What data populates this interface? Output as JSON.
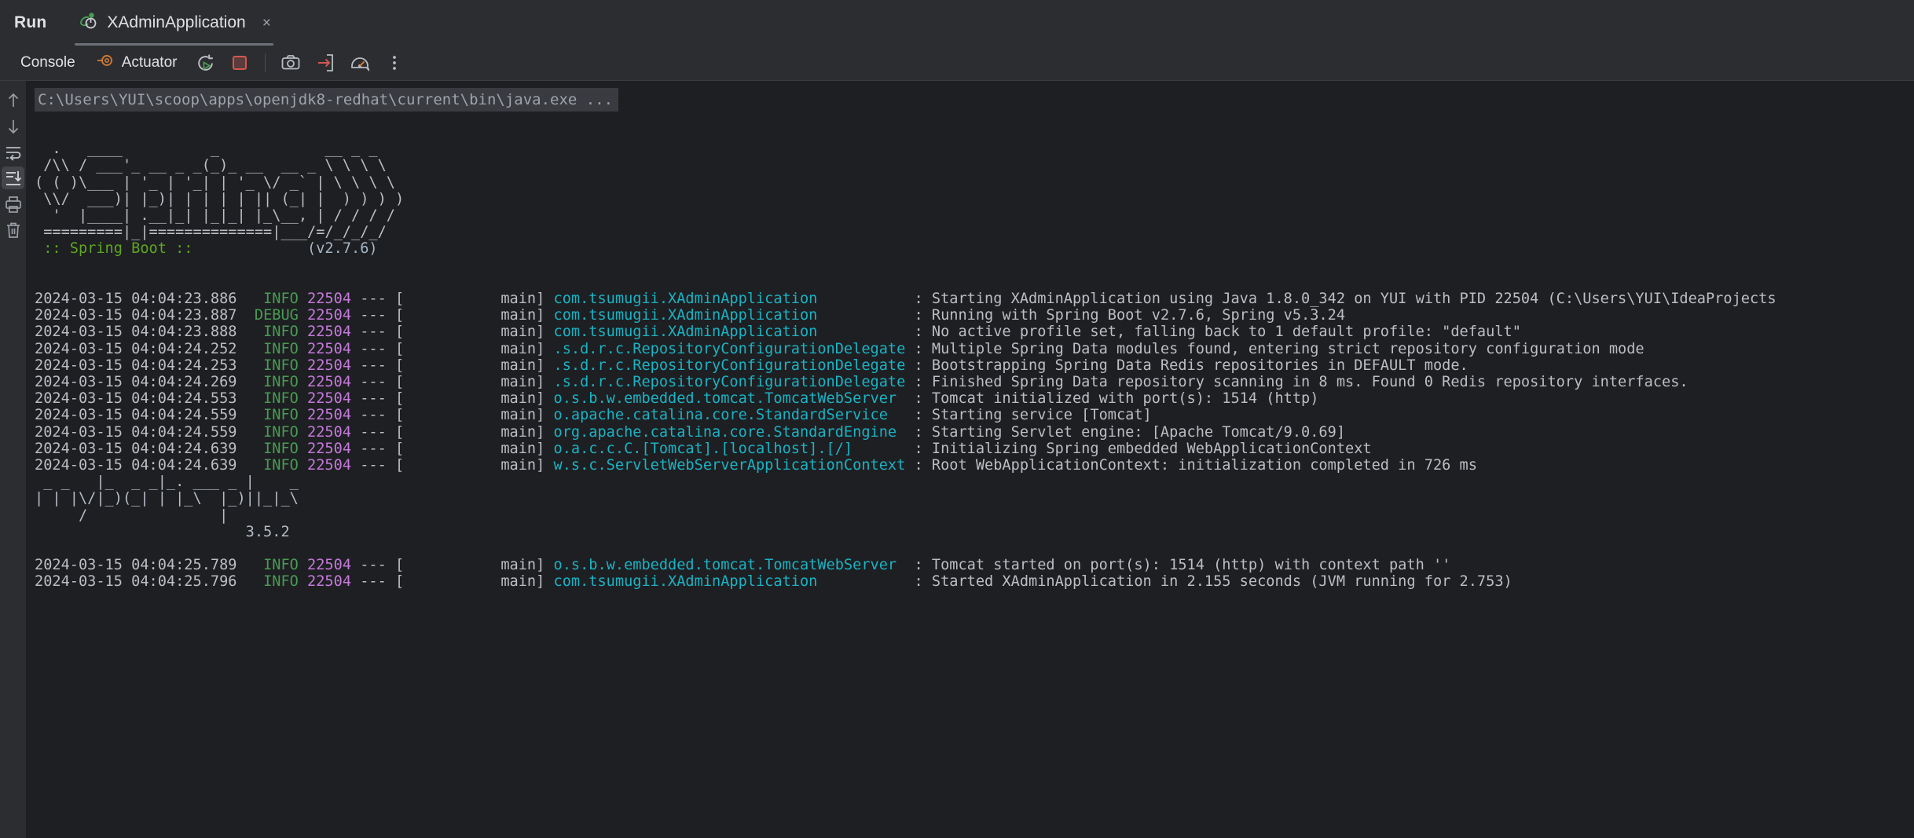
{
  "window": {
    "run_label": "Run",
    "tab_title": "XAdminApplication",
    "tab_close": "×",
    "tab_icon": "spring-run-config-icon"
  },
  "toolbar": {
    "console_label": "Console",
    "actuator_label": "Actuator",
    "actuator_icon": "actuator-icon",
    "rerun_icon": "rerun-icon",
    "stop_icon": "stop-icon",
    "camera_icon": "camera-icon",
    "thread-dump_icon": "thread-dump-icon",
    "gauge_icon": "gauge-icon",
    "more_icon": "more-vertical-icon"
  },
  "gutter": {
    "up_icon": "arrow-up-icon",
    "down_icon": "arrow-down-icon",
    "softwrap_icon": "soft-wrap-icon",
    "scroll_end_icon": "scroll-to-end-icon",
    "print_icon": "print-icon",
    "trash_icon": "trash-icon"
  },
  "console": {
    "command_line": "C:\\Users\\YUI\\scoop\\apps\\openjdk8-redhat\\current\\bin\\java.exe ...",
    "spring_banner": [
      "  .   ____          _            __ _ _",
      " /\\\\ / ___'_ __ _ _(_)_ __  __ _ \\ \\ \\ \\",
      "( ( )\\___ | '_ | '_| | '_ \\/ _` | \\ \\ \\ \\",
      " \\\\/  ___)| |_)| | | | | || (_| |  ) ) ) )",
      "  '  |____| .__|_| |_|_| |_\\__, | / / / /",
      " =========|_|==============|___/=/_/_/_/"
    ],
    "spring_boot_label": " :: Spring Boot :: ",
    "spring_boot_version": "(v2.7.6)",
    "mybatis_banner": [
      " _ _   |_  _ _|_. ___ _ |    _",
      "| | |\\/|_)(_| | |_\\  |_)||_|_\\",
      "     /               |",
      "                        3.5.2"
    ],
    "log_lines": [
      {
        "time": "2024-03-15 04:04:23.886",
        "level": "INFO",
        "level_pad_left": "  ",
        "pid": "22504",
        "thread": "main",
        "logger": "com.tsumugii.XAdminApplication",
        "message": "Starting XAdminApplication using Java 1.8.0_342 on YUI with PID 22504 (C:\\Users\\YUI\\IdeaProjects"
      },
      {
        "time": "2024-03-15 04:04:23.887",
        "level": "DEBUG",
        "level_pad_left": " ",
        "pid": "22504",
        "thread": "main",
        "logger": "com.tsumugii.XAdminApplication",
        "message": "Running with Spring Boot v2.7.6, Spring v5.3.24"
      },
      {
        "time": "2024-03-15 04:04:23.888",
        "level": "INFO",
        "level_pad_left": "  ",
        "pid": "22504",
        "thread": "main",
        "logger": "com.tsumugii.XAdminApplication",
        "message": "No active profile set, falling back to 1 default profile: \"default\""
      },
      {
        "time": "2024-03-15 04:04:24.252",
        "level": "INFO",
        "level_pad_left": "  ",
        "pid": "22504",
        "thread": "main",
        "logger": ".s.d.r.c.RepositoryConfigurationDelegate",
        "message": "Multiple Spring Data modules found, entering strict repository configuration mode"
      },
      {
        "time": "2024-03-15 04:04:24.253",
        "level": "INFO",
        "level_pad_left": "  ",
        "pid": "22504",
        "thread": "main",
        "logger": ".s.d.r.c.RepositoryConfigurationDelegate",
        "message": "Bootstrapping Spring Data Redis repositories in DEFAULT mode."
      },
      {
        "time": "2024-03-15 04:04:24.269",
        "level": "INFO",
        "level_pad_left": "  ",
        "pid": "22504",
        "thread": "main",
        "logger": ".s.d.r.c.RepositoryConfigurationDelegate",
        "message": "Finished Spring Data repository scanning in 8 ms. Found 0 Redis repository interfaces."
      },
      {
        "time": "2024-03-15 04:04:24.553",
        "level": "INFO",
        "level_pad_left": "  ",
        "pid": "22504",
        "thread": "main",
        "logger": "o.s.b.w.embedded.tomcat.TomcatWebServer",
        "message": "Tomcat initialized with port(s): 1514 (http)"
      },
      {
        "time": "2024-03-15 04:04:24.559",
        "level": "INFO",
        "level_pad_left": "  ",
        "pid": "22504",
        "thread": "main",
        "logger": "o.apache.catalina.core.StandardService",
        "message": "Starting service [Tomcat]"
      },
      {
        "time": "2024-03-15 04:04:24.559",
        "level": "INFO",
        "level_pad_left": "  ",
        "pid": "22504",
        "thread": "main",
        "logger": "org.apache.catalina.core.StandardEngine",
        "message": "Starting Servlet engine: [Apache Tomcat/9.0.69]"
      },
      {
        "time": "2024-03-15 04:04:24.639",
        "level": "INFO",
        "level_pad_left": "  ",
        "pid": "22504",
        "thread": "main",
        "logger": "o.a.c.c.C.[Tomcat].[localhost].[/]",
        "message": "Initializing Spring embedded WebApplicationContext"
      },
      {
        "time": "2024-03-15 04:04:24.639",
        "level": "INFO",
        "level_pad_left": "  ",
        "pid": "22504",
        "thread": "main",
        "logger": "w.s.c.ServletWebServerApplicationContext",
        "message": "Root WebApplicationContext: initialization completed in 726 ms"
      }
    ],
    "log_lines_after_mybatis": [
      {
        "time": "2024-03-15 04:04:25.789",
        "level": "INFO",
        "level_pad_left": "  ",
        "pid": "22504",
        "thread": "main",
        "logger": "o.s.b.w.embedded.tomcat.TomcatWebServer",
        "message": "Tomcat started on port(s): 1514 (http) with context path ''"
      },
      {
        "time": "2024-03-15 04:04:25.796",
        "level": "INFO",
        "level_pad_left": "  ",
        "pid": "22504",
        "thread": "main",
        "logger": "com.tsumugii.XAdminApplication",
        "message": "Started XAdminApplication in 2.155 seconds (JVM running for 2.753)"
      }
    ]
  },
  "colors": {
    "bg_console": "#1e1f22",
    "bg_chrome": "#2b2d30",
    "level_info": "#499c54",
    "pid": "#c679dd",
    "logger": "#1ab3c4",
    "text": "#bcbec4",
    "spring_green": "#5ea524",
    "accent_red": "#d0584f",
    "accent_orange": "#cc7832"
  }
}
